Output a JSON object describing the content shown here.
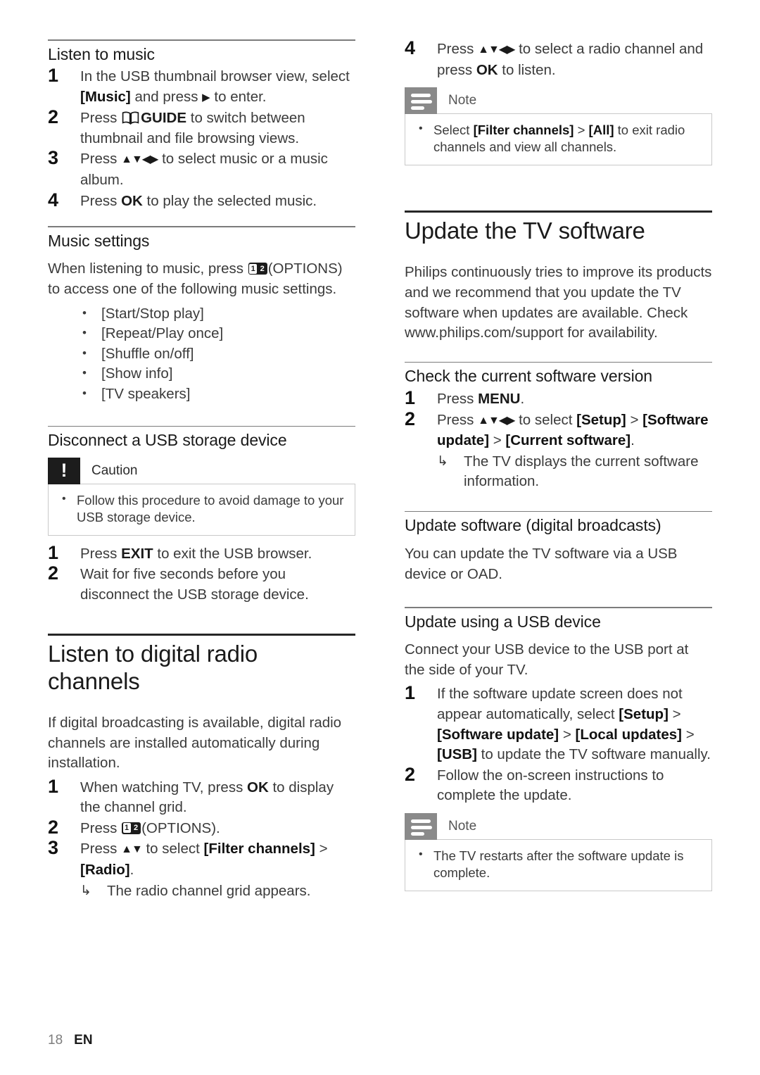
{
  "document": {
    "footer": {
      "page_number": "18",
      "language": "EN"
    }
  },
  "left_column": {
    "music_section": {
      "heading": "Listen to music",
      "steps": [
        {
          "num": "1",
          "text_before": "In the USB thumbnail browser view, select ",
          "bold1": "[Music]",
          "text_mid": " and press ",
          "icon": "▶",
          "text_after": " to enter."
        },
        {
          "num": "2",
          "text_before": "Press ",
          "icon_name": "guide-book-icon",
          "kbd": "GUIDE",
          "text_after": " to switch between thumbnail and file browsing views."
        },
        {
          "num": "3",
          "text_before": "Press ",
          "arrows": "▲▼◀▶",
          "text_after": " to select music or a music album."
        },
        {
          "num": "4",
          "text_before": "Press ",
          "kbd": "OK",
          "text_after": " to play the selected music."
        }
      ]
    },
    "music_settings": {
      "heading": "Music settings",
      "intro_before": "When listening to music, press ",
      "intro_after": "(OPTIONS) to access one of the following music settings.",
      "options": [
        "[Start/Stop play]",
        "[Repeat/Play once]",
        "[Shuffle on/off]",
        "[Show info]",
        "[TV speakers]"
      ]
    },
    "disconnect_section": {
      "heading": "Disconnect a USB storage device",
      "caution": {
        "title": "Caution",
        "icon": "caution-exclamation-icon",
        "items": [
          "Follow this procedure to avoid damage to your USB storage device."
        ]
      },
      "steps": [
        {
          "num": "1",
          "text_before": "Press ",
          "kbd": "EXIT",
          "text_after": " to exit the USB browser."
        },
        {
          "num": "2",
          "text_before": "Wait for five seconds before you disconnect the USB storage device.",
          "kbd": "",
          "text_after": ""
        }
      ]
    },
    "radio_section": {
      "heading": "Listen to digital radio channels",
      "intro": "If digital broadcasting is available, digital radio channels are installed automatically during installation.",
      "steps": [
        {
          "num": "1",
          "text_before": "When watching TV, press ",
          "kbd": "OK",
          "text_after": " to display the channel grid."
        },
        {
          "num": "2",
          "text_before": "Press ",
          "text_after": "(OPTIONS)."
        },
        {
          "num": "3",
          "text_before": "Press ",
          "arrows": "▲▼",
          "text_mid": " to select ",
          "bold1": "[Filter channels]",
          "gt": " > ",
          "bold2": "[Radio]",
          "text_after": ".",
          "result": "The radio channel grid appears."
        }
      ]
    }
  },
  "right_column": {
    "radio_continued": {
      "steps": [
        {
          "num": "4",
          "text_before": "Press ",
          "arrows": "▲▼◀▶",
          "text_mid": " to select a radio channel and press ",
          "kbd": "OK",
          "text_after": " to listen."
        }
      ],
      "note": {
        "title": "Note",
        "icon": "note-lines-icon",
        "item_before": "Select ",
        "item_bold1": "[Filter channels]",
        "item_gt": " > ",
        "item_bold2": "[All]",
        "item_after": " to exit radio channels and view all channels."
      }
    },
    "update_section": {
      "heading": "Update the TV software",
      "intro": "Philips continuously tries to improve its products and we recommend that you update the TV software when updates are available. Check www.philips.com/support for availability."
    },
    "check_version": {
      "heading": "Check the current software version",
      "steps": [
        {
          "num": "1",
          "text_before": "Press ",
          "kbd": "MENU",
          "text_after": "."
        },
        {
          "num": "2",
          "text_before": "Press ",
          "arrows": "▲▼◀▶",
          "text_mid": " to select ",
          "bold1": "[Setup]",
          "gt1": " > ",
          "bold2": "[Software update]",
          "gt2": " > ",
          "bold3": "[Current software]",
          "text_after": ".",
          "result": "The TV displays the current software information."
        }
      ]
    },
    "update_broadcasts": {
      "heading": "Update software (digital broadcasts)",
      "text": "You can update the TV software via a USB device or OAD."
    },
    "update_usb": {
      "heading": "Update using a USB device",
      "intro": "Connect your USB device to the USB port at the side of your TV.",
      "steps": [
        {
          "num": "1",
          "text_before": "If the software update screen does not appear automatically, select ",
          "bold1": "[Setup]",
          "gt1": " > ",
          "bold2": "[Software update]",
          "gt2": " > ",
          "bold3": "[Local updates]",
          "gt3": " > ",
          "bold4": "[USB]",
          "text_after": " to update the TV software manually."
        },
        {
          "num": "2",
          "text_before": "Follow the on-screen instructions to complete the update."
        }
      ],
      "note": {
        "title": "Note",
        "icon": "note-lines-icon",
        "item": "The TV restarts after the software update is complete."
      }
    }
  }
}
